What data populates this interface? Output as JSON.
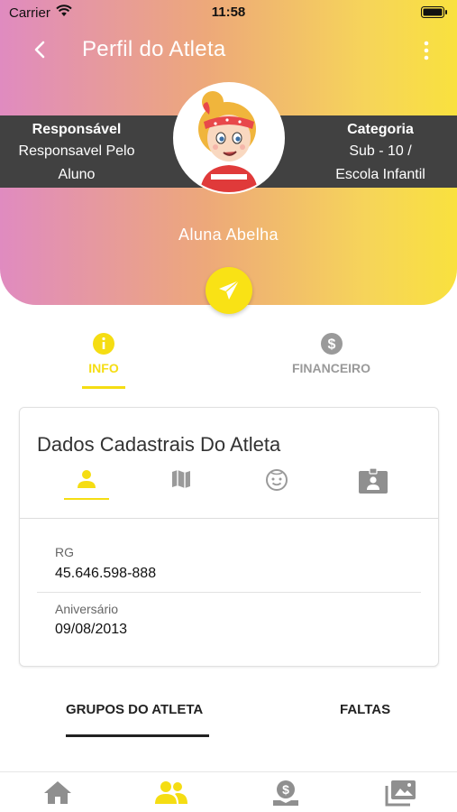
{
  "status_bar": {
    "carrier": "Carrier",
    "time": "11:58"
  },
  "header": {
    "title": "Perfil do Atleta",
    "responsavel_label": "Responsável",
    "responsavel_line1": "Responsavel Pelo",
    "responsavel_line2": "Aluno",
    "categoria_label": "Categoria",
    "categoria_line1": "Sub - 10 /",
    "categoria_line2": "Escola Infantil",
    "athlete_name": "Aluna Abelha"
  },
  "tabs": {
    "info": "INFO",
    "financeiro": "FINANCEIRO"
  },
  "card": {
    "title": "Dados Cadastrais Do Atleta",
    "fields": [
      {
        "label": "RG",
        "value": "45.646.598-888"
      },
      {
        "label": "Aniversário",
        "value": "09/08/2013"
      }
    ]
  },
  "sections": {
    "grupos": "GRUPOS DO ATLETA",
    "faltas": "FALTAS"
  },
  "colors": {
    "accent": "#f5dd13",
    "band": "#414141",
    "inactive": "#9a9a9a"
  },
  "icons": {
    "bottom_nav": [
      "home-icon",
      "group-icon",
      "money-icon",
      "gallery-icon"
    ],
    "sub_tabs": [
      "person-icon",
      "map-icon",
      "face-icon",
      "badge-icon"
    ]
  }
}
